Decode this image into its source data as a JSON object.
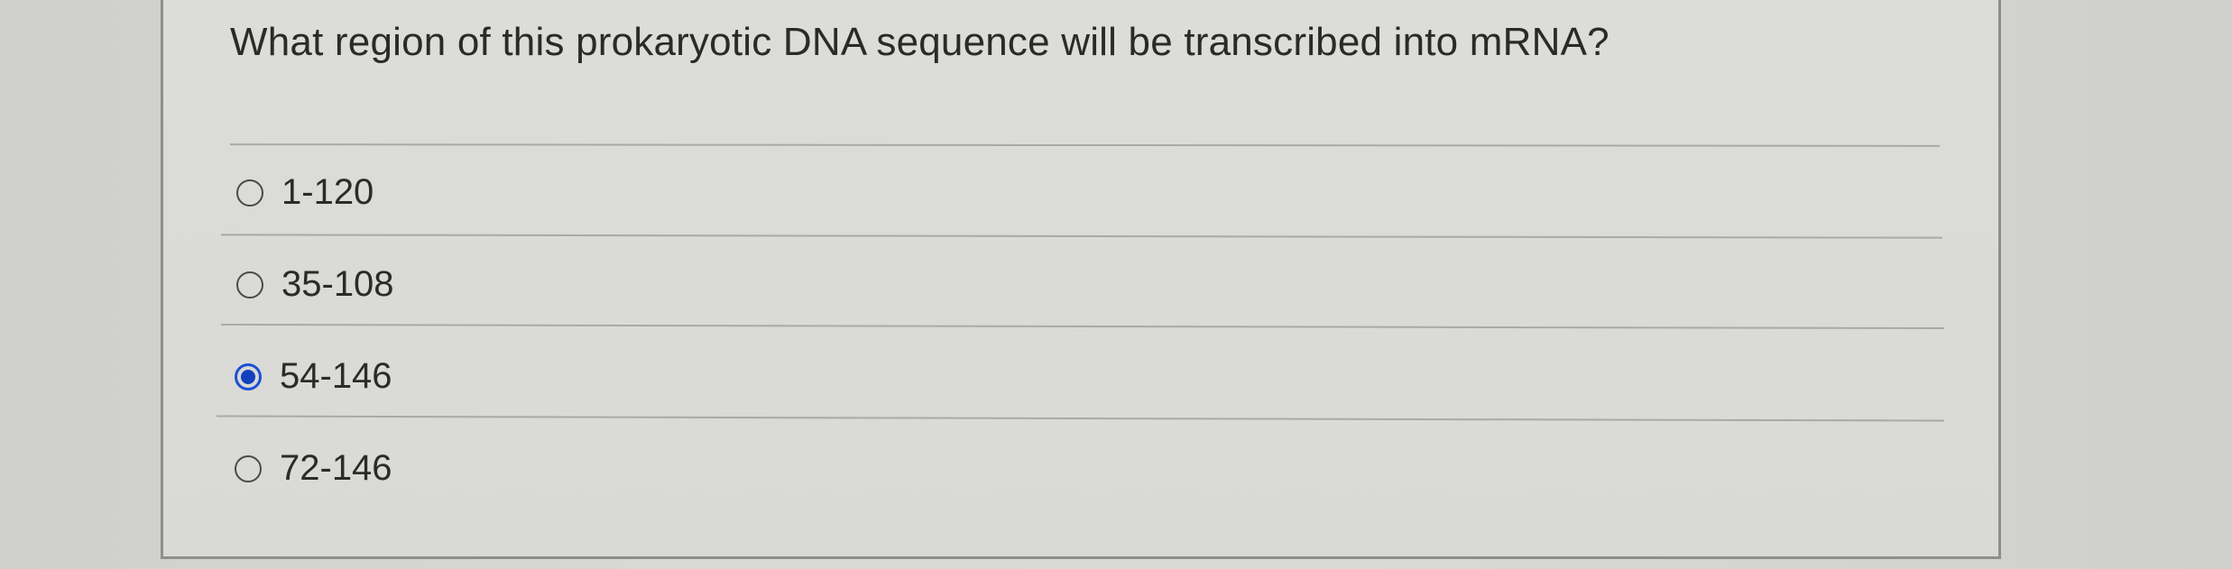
{
  "question": {
    "text": "What region of this prokaryotic DNA sequence will be transcribed into mRNA?"
  },
  "options": [
    {
      "label": "1-120",
      "selected": false
    },
    {
      "label": "35-108",
      "selected": false
    },
    {
      "label": "54-146",
      "selected": true
    },
    {
      "label": "72-146",
      "selected": false
    }
  ],
  "colors": {
    "selected_radio": "#1d4fd6",
    "text": "#2a2a2a"
  }
}
